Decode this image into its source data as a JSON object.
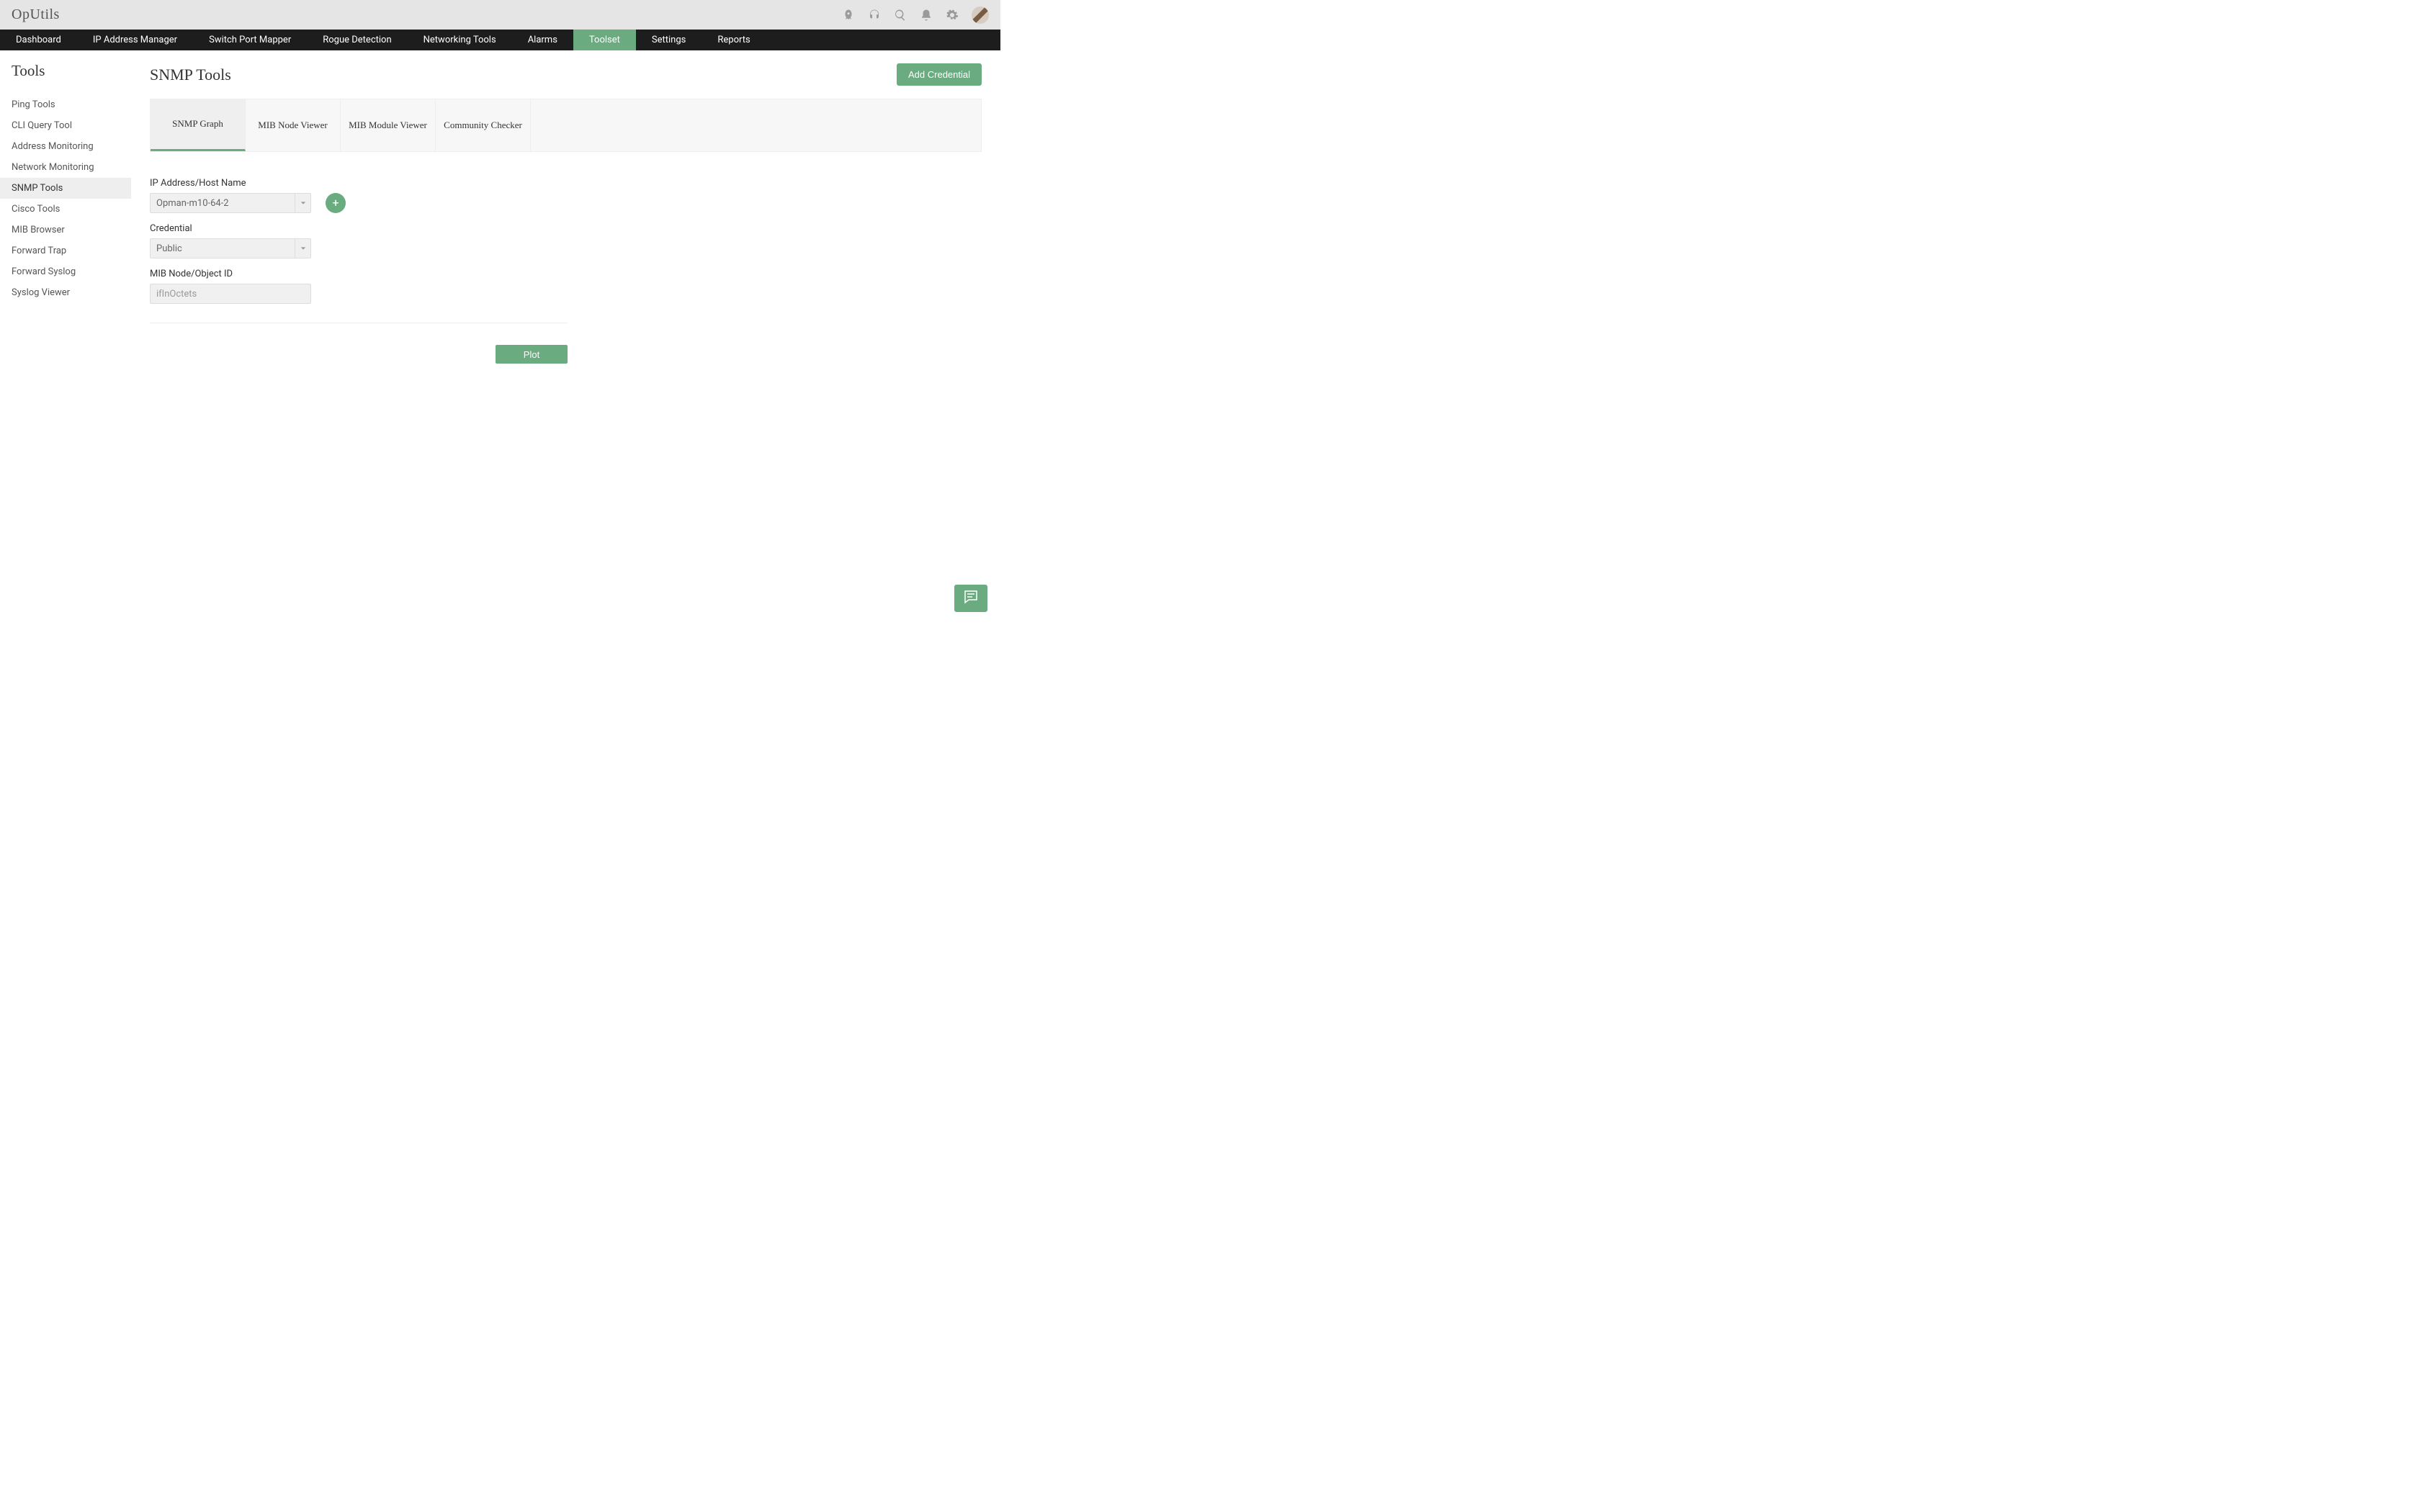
{
  "brand": "OpUtils",
  "nav": {
    "items": [
      {
        "label": "Dashboard"
      },
      {
        "label": "IP Address Manager"
      },
      {
        "label": "Switch Port Mapper"
      },
      {
        "label": "Rogue Detection"
      },
      {
        "label": "Networking Tools"
      },
      {
        "label": "Alarms"
      },
      {
        "label": "Toolset",
        "active": true
      },
      {
        "label": "Settings"
      },
      {
        "label": "Reports"
      }
    ]
  },
  "sidebar": {
    "title": "Tools",
    "items": [
      {
        "label": "Ping Tools"
      },
      {
        "label": "CLI Query Tool"
      },
      {
        "label": "Address Monitoring"
      },
      {
        "label": "Network Monitoring"
      },
      {
        "label": "SNMP Tools",
        "active": true
      },
      {
        "label": "Cisco Tools"
      },
      {
        "label": "MIB Browser"
      },
      {
        "label": "Forward Trap"
      },
      {
        "label": "Forward Syslog"
      },
      {
        "label": "Syslog Viewer"
      }
    ]
  },
  "page": {
    "title": "SNMP Tools",
    "add_credential_label": "Add Credential"
  },
  "tabs": [
    {
      "label": "SNMP Graph",
      "active": true
    },
    {
      "label": "MIB Node Viewer"
    },
    {
      "label": "MIB Module Viewer"
    },
    {
      "label": "Community Checker"
    }
  ],
  "form": {
    "host_label": "IP Address/Host Name",
    "host_value": "Opman-m10-64-2",
    "credential_label": "Credential",
    "credential_value": "Public",
    "mib_label": "MIB Node/Object ID",
    "mib_value": "ifInOctets",
    "plus_label": "+",
    "plot_label": "Plot"
  }
}
